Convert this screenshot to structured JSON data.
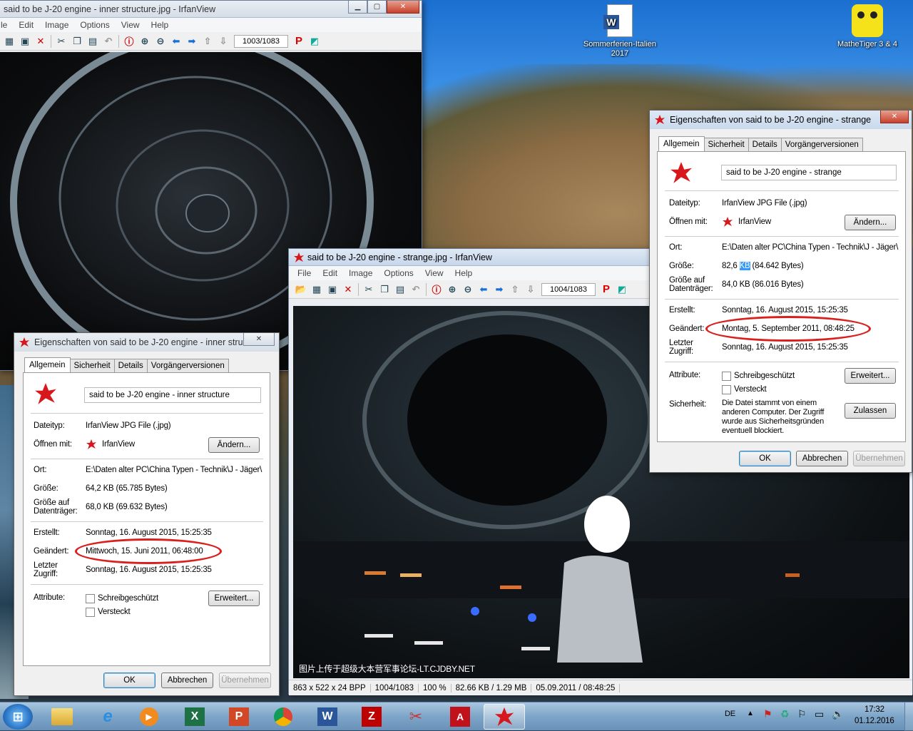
{
  "desktop": {
    "icons": [
      {
        "label": "Sommerferien-Italien 2017"
      },
      {
        "label": "MatheTiger 3 & 4"
      }
    ]
  },
  "irfan1": {
    "title": "said to be J-20 engine - inner structure.jpg - IrfanView",
    "menu": [
      "le",
      "Edit",
      "Image",
      "Options",
      "View",
      "Help"
    ],
    "counter": "1003/1083"
  },
  "irfan2": {
    "title": "said to be J-20 engine - strange.jpg - IrfanView",
    "menu": [
      "File",
      "Edit",
      "Image",
      "Options",
      "View",
      "Help"
    ],
    "counter": "1004/1083",
    "watermark": "图片上传于超级大本营军事论坛-LT.CJDBY.NET",
    "status": [
      "863 x 522 x 24 BPP",
      "1004/1083",
      "100 %",
      "82.66 KB / 1.29 MB",
      "05.09.2011 / 08:48:25"
    ]
  },
  "dlg1": {
    "title": "Eigenschaften von said to be J-20 engine - inner stru...",
    "tabs": [
      "Allgemein",
      "Sicherheit",
      "Details",
      "Vorgängerversionen"
    ],
    "filename": "said to be J-20 engine - inner structure",
    "dateityp_label": "Dateityp:",
    "dateityp": "IrfanView JPG File (.jpg)",
    "oeffnen_label": "Öffnen mit:",
    "oeffnen": "IrfanView",
    "aendern": "Ändern...",
    "ort_label": "Ort:",
    "ort": "E:\\Daten alter PC\\China Typen - Technik\\J - Jäger\\",
    "groesse_label": "Größe:",
    "groesse": "64,2 KB (65.785 Bytes)",
    "groesse_auf_label1": "Größe auf",
    "groesse_auf_label2": "Datenträger:",
    "groesse_auf": "68,0 KB (69.632 Bytes)",
    "erstellt_label": "Erstellt:",
    "erstellt": "Sonntag, 16. August 2015, 15:25:35",
    "geaendert_label": "Geändert:",
    "geaendert": "Mittwoch, 15. Juni 2011, 06:48:00",
    "letzter_label1": "Letzter",
    "letzter_label2": "Zugriff:",
    "letzter": "Sonntag, 16. August 2015, 15:25:35",
    "attribute_label": "Attribute:",
    "schreib": "Schreibgeschützt",
    "versteckt": "Versteckt",
    "erweitert": "Erweitert...",
    "ok": "OK",
    "abbrechen": "Abbrechen",
    "uebernehmen": "Übernehmen"
  },
  "dlg2": {
    "title": "Eigenschaften von said to be J-20 engine - strange",
    "tabs": [
      "Allgemein",
      "Sicherheit",
      "Details",
      "Vorgängerversionen"
    ],
    "filename": "said to be J-20 engine - strange",
    "dateityp_label": "Dateityp:",
    "dateityp": "IrfanView JPG File (.jpg)",
    "oeffnen_label": "Öffnen mit:",
    "oeffnen": "IrfanView",
    "aendern": "Ändern...",
    "ort_label": "Ort:",
    "ort": "E:\\Daten alter PC\\China Typen - Technik\\J - Jäger\\",
    "groesse_label": "Größe:",
    "groesse_a": "82,6 ",
    "groesse_hl": "KB",
    "groesse_b": " (84.642 Bytes)",
    "groesse_auf_label1": "Größe auf",
    "groesse_auf_label2": "Datenträger:",
    "groesse_auf": "84,0 KB (86.016 Bytes)",
    "erstellt_label": "Erstellt:",
    "erstellt": "Sonntag, 16. August 2015, 15:25:35",
    "geaendert_label": "Geändert:",
    "geaendert": "Montag, 5. September 2011, 08:48:25",
    "letzter_label1": "Letzter",
    "letzter_label2": "Zugriff:",
    "letzter": "Sonntag, 16. August 2015, 15:25:35",
    "attribute_label": "Attribute:",
    "schreib": "Schreibgeschützt",
    "versteckt": "Versteckt",
    "erweitert": "Erweitert...",
    "sicherheit_label": "Sicherheit:",
    "sicherheit_text": [
      "Die Datei stammt von einem",
      "anderen Computer. Der Zugriff",
      "wurde aus Sicherheitsgründen",
      "eventuell blockiert."
    ],
    "zulassen": "Zulassen",
    "ok": "OK",
    "abbrechen": "Abbrechen",
    "uebernehmen": "Übernehmen"
  },
  "taskbar": {
    "lang": "DE",
    "time": "17:32",
    "date": "01.12.2016"
  },
  "colors": {
    "accent_red": "#d9201e",
    "taskbar": "#7da5c8"
  }
}
